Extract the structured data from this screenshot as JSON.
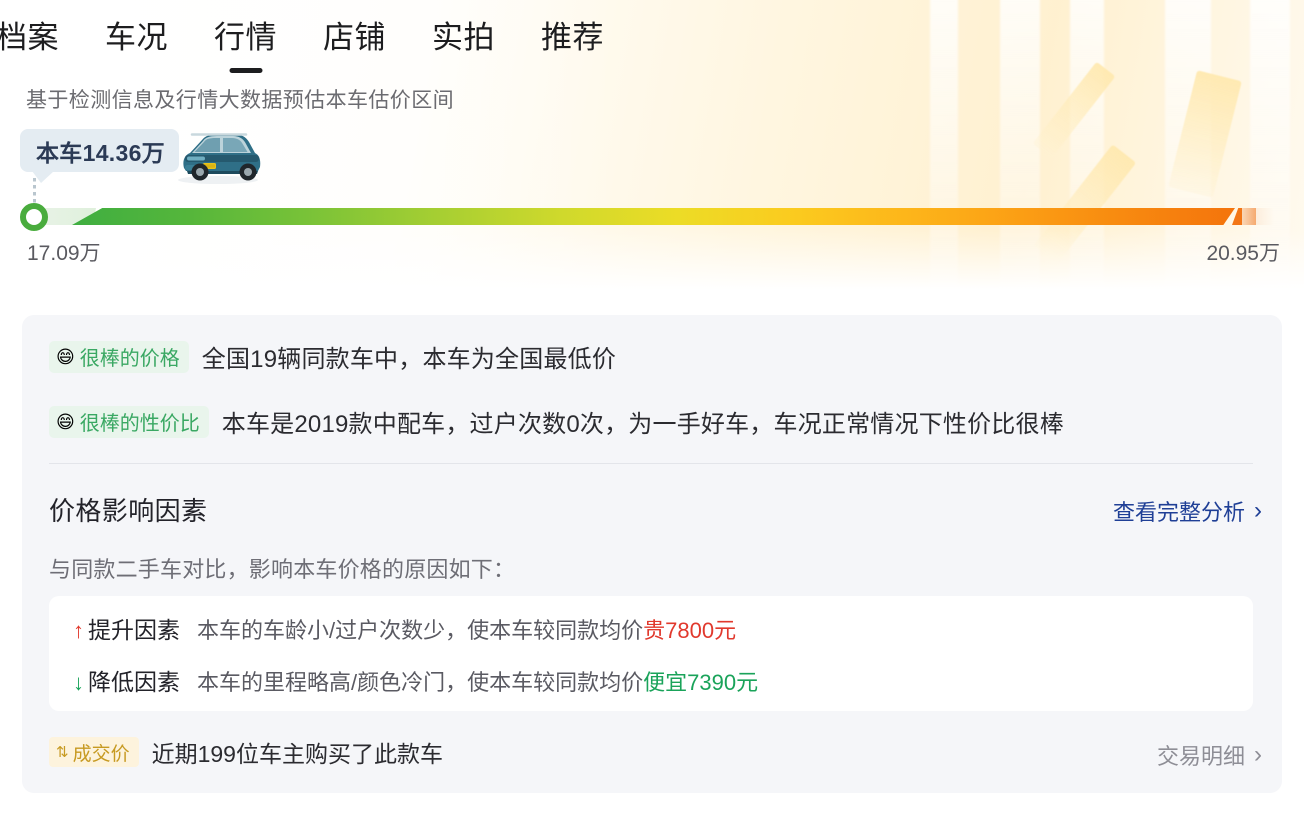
{
  "tabs": [
    {
      "label": "档案",
      "active": false
    },
    {
      "label": "车况",
      "active": false
    },
    {
      "label": "行情",
      "active": true
    },
    {
      "label": "店铺",
      "active": false
    },
    {
      "label": "实拍",
      "active": false
    },
    {
      "label": "推荐",
      "active": false
    }
  ],
  "estimate": {
    "subtitle": "基于检测信息及行情大数据预估本车估价区间",
    "bubble_label": "本车14.36万",
    "price_low": "17.09万",
    "price_high": "20.95万"
  },
  "verdicts": [
    {
      "tag_emoji": "😄",
      "tag_label": "很棒的价格",
      "text": "全国19辆同款车中，本车为全国最低价"
    },
    {
      "tag_emoji": "😄",
      "tag_label": "很棒的性价比",
      "text": "本车是2019款中配车，过户次数0次，为一手好车，车况正常情况下性价比很棒"
    }
  ],
  "price_factors": {
    "title": "价格影响因素",
    "full_analysis_label": "查看完整分析",
    "full_analysis_chevron": "›",
    "compare_note": "与同款二手车对比，影响本车价格的原因如下：",
    "rows": [
      {
        "arrow": "↑",
        "label": "提升因素",
        "desc": "本车的车龄小/过户次数少，使本车较同款均价",
        "amount": "贵7800元"
      },
      {
        "arrow": "↓",
        "label": "降低因素",
        "desc": "本车的里程略高/颜色冷门，使本车较同款均价",
        "amount": "便宜7390元"
      }
    ]
  },
  "deal": {
    "tag_icon": "⇅",
    "tag_label": "成交价",
    "text": "近期199位车主购买了此款车",
    "detail_label": "交易明细",
    "detail_chevron": "›"
  },
  "colors": {
    "accent_blue": "#1f3f96",
    "up_red": "#e1392d",
    "down_green": "#1aa35a",
    "tag_green": "#3aa863",
    "gold": "#c79a22",
    "card_bg": "#f5f6f9"
  }
}
